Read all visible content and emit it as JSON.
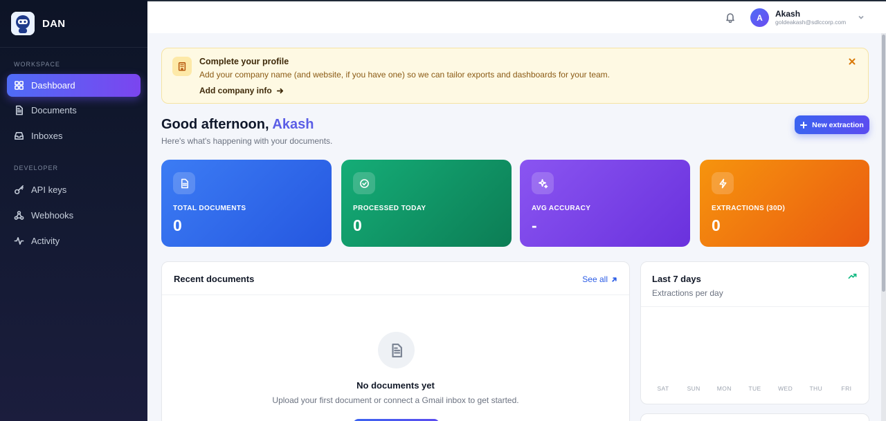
{
  "brand": {
    "name": "DAN"
  },
  "sidebar": {
    "workspace_label": "WORKSPACE",
    "developer_label": "DEVELOPER",
    "workspace_items": [
      {
        "label": "Dashboard",
        "icon": "grid-icon",
        "active": true
      },
      {
        "label": "Documents",
        "icon": "document-icon",
        "active": false
      },
      {
        "label": "Inboxes",
        "icon": "inbox-icon",
        "active": false
      }
    ],
    "developer_items": [
      {
        "label": "API keys",
        "icon": "key-icon"
      },
      {
        "label": "Webhooks",
        "icon": "webhook-icon"
      },
      {
        "label": "Activity",
        "icon": "activity-icon"
      }
    ]
  },
  "header": {
    "user": {
      "initial": "A",
      "name": "Akash",
      "email": "goldeakash@sdlccorp.com"
    }
  },
  "banner": {
    "title": "Complete your profile",
    "text": "Add your company name (and website, if you have one) so we can tailor exports and dashboards for your team.",
    "link_label": "Add company info"
  },
  "greeting": {
    "prefix": "Good afternoon,",
    "name": "Akash",
    "subtitle": "Here's what's happening with your documents."
  },
  "actions": {
    "new_extraction_label": "New extraction"
  },
  "stats": [
    {
      "label": "TOTAL DOCUMENTS",
      "value": "0",
      "icon": "document-icon",
      "color": "#2f6bec"
    },
    {
      "label": "PROCESSED TODAY",
      "value": "0",
      "icon": "check-circle-icon",
      "color": "#119a69"
    },
    {
      "label": "AVG ACCURACY",
      "value": "-",
      "icon": "sparkles-icon",
      "color": "#7b44e8"
    },
    {
      "label": "EXTRACTIONS (30D)",
      "value": "0",
      "icon": "lightning-icon",
      "color": "#f07a10"
    }
  ],
  "recent": {
    "title": "Recent documents",
    "see_all_label": "See all",
    "empty_title": "No documents yet",
    "empty_text": "Upload your first document or connect a Gmail inbox to get started."
  },
  "week": {
    "title": "Last 7 days",
    "subtitle": "Extractions per day",
    "days": [
      "SAT",
      "SUN",
      "MON",
      "TUE",
      "WED",
      "THU",
      "FRI"
    ]
  },
  "colors": {
    "accent": "#5b5ee6",
    "sidebar_bg": "#111830",
    "banner_bg": "#fef9e3"
  }
}
